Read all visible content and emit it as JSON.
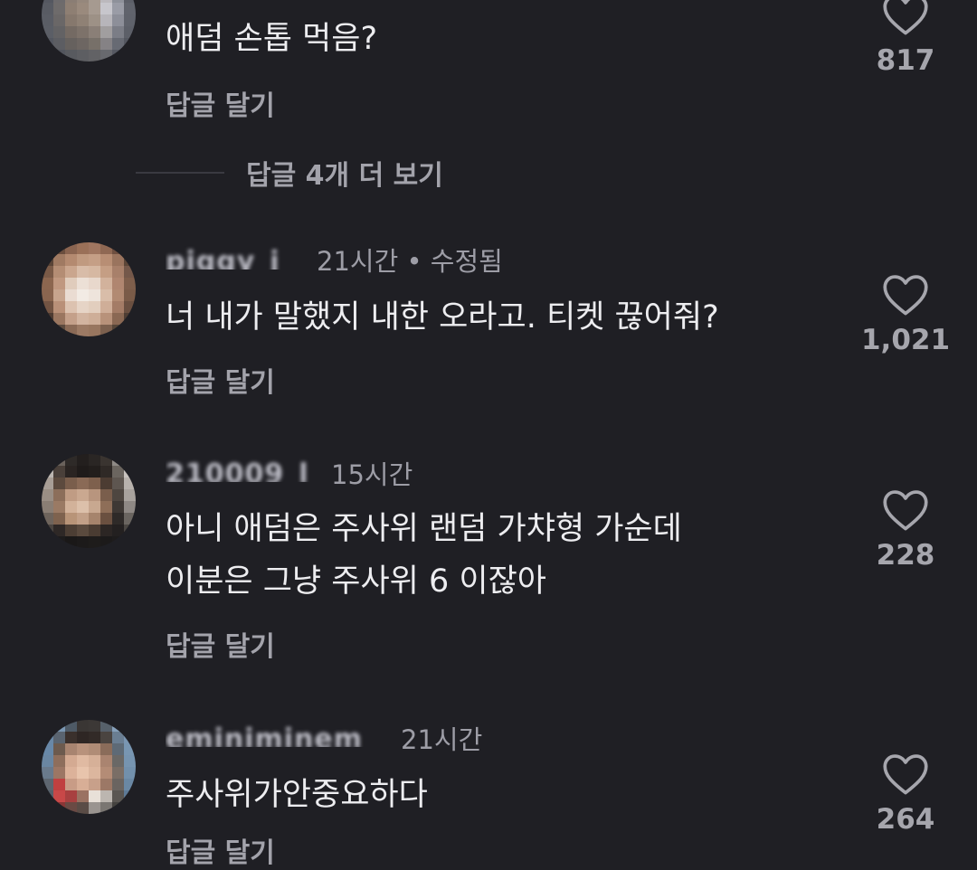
{
  "colors": {
    "background": "#1f1f24",
    "text_primary": "#ededf0",
    "text_secondary": "#9d9da6",
    "action_text": "#a3a3ab"
  },
  "icons": {
    "like": "heart-outline-icon"
  },
  "more_replies_label": "답글 4개 더 보기",
  "comments": [
    {
      "text_lines": [
        "애덤 손톱 먹음?"
      ],
      "reply_label": "답글 달기",
      "like_count": "817"
    },
    {
      "username": "piggy_j",
      "time": "21시간",
      "edited": "• 수정됨",
      "text_lines": [
        "너 내가 말했지 내한 오라고. 티켓 끊어줘?"
      ],
      "reply_label": "답글 달기",
      "like_count": "1,021"
    },
    {
      "username": "210009_l",
      "time": "15시간",
      "text_lines": [
        "아니 애덤은 주사위 랜덤 가챠형 가순데",
        "이분은 그냥 주사위 6 이잖아"
      ],
      "reply_label": "답글 달기",
      "like_count": "228"
    },
    {
      "username": "eminiminem",
      "time": "21시간",
      "text_lines": [
        "주사위가안중요하다"
      ],
      "reply_label": "답글 달기",
      "like_count": "264"
    }
  ]
}
